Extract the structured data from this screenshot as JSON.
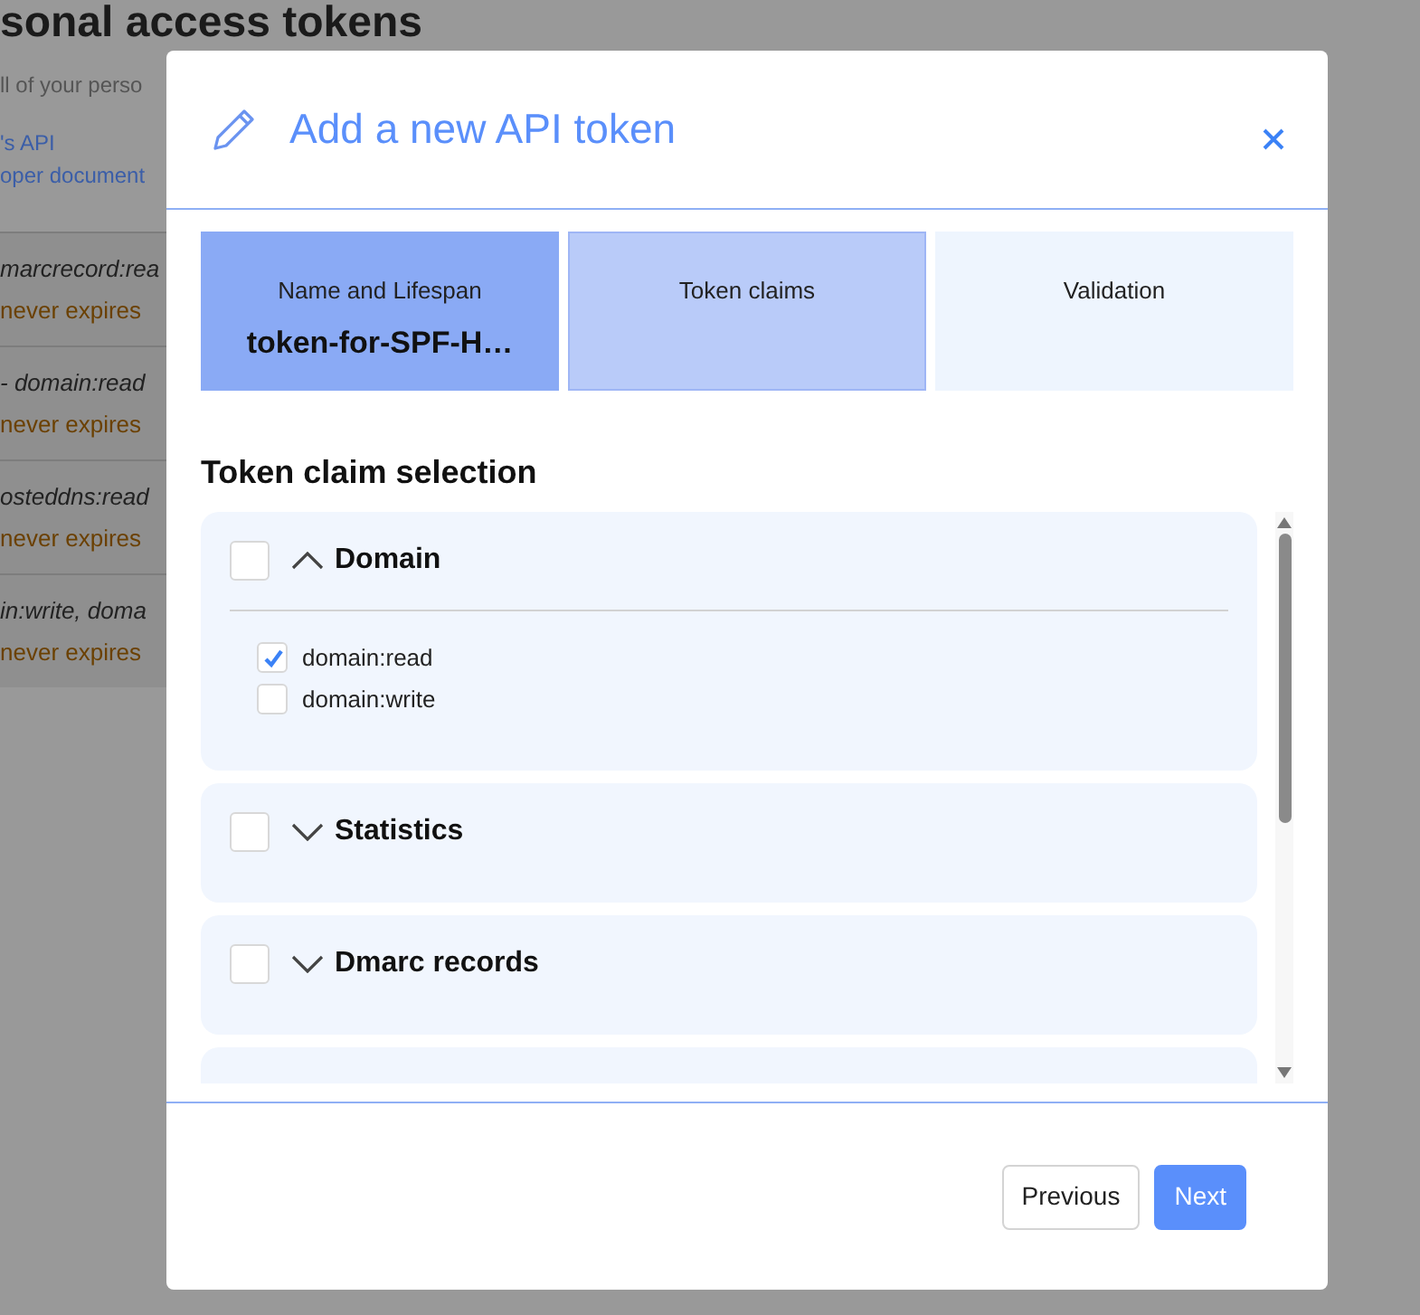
{
  "background": {
    "title": "sonal access tokens",
    "intro": "ll of your perso",
    "links": [
      "'s API",
      "oper document"
    ],
    "rows": [
      {
        "scopes": "marcrecord:rea",
        "expiry": "never expires"
      },
      {
        "scopes": "- domain:read",
        "expiry": "never expires"
      },
      {
        "scopes": "osteddns:read",
        "expiry": "never expires"
      },
      {
        "scopes": "in:write, doma",
        "expiry": "never expires"
      }
    ]
  },
  "dialog": {
    "title": "Add a new API token",
    "steps": [
      {
        "label": "Name and Lifespan",
        "value": "token-for-SPF-H…",
        "completed": true,
        "selected": false
      },
      {
        "label": "Token claims",
        "completed": false,
        "selected": true
      },
      {
        "label": "Validation",
        "completed": false,
        "selected": false
      }
    ],
    "section_title": "Token claim selection",
    "groups": [
      {
        "name": "Domain",
        "checked": false,
        "expanded": true,
        "claims": [
          {
            "label": "domain:read",
            "checked": true
          },
          {
            "label": "domain:write",
            "checked": false
          }
        ]
      },
      {
        "name": "Statistics",
        "checked": false,
        "expanded": false
      },
      {
        "name": "Dmarc records",
        "checked": false,
        "expanded": false
      }
    ],
    "buttons": [
      {
        "label": "Previous",
        "kind": "secondary"
      },
      {
        "label": "Next",
        "kind": "primary"
      }
    ]
  }
}
